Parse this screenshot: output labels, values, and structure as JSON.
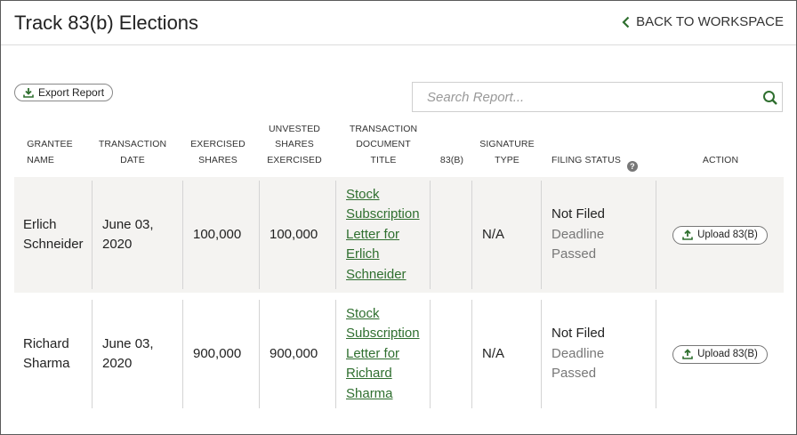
{
  "header": {
    "title": "Track 83(b) Elections",
    "back_label": "BACK TO WORKSPACE"
  },
  "toolbar": {
    "export_label": "Export Report",
    "search_placeholder": "Search Report..."
  },
  "table": {
    "columns": [
      "GRANTEE\nNAME",
      "TRANSACTION\nDATE",
      "EXERCISED\nSHARES",
      "UNVESTED\nSHARES\nEXERCISED",
      "TRANSACTION\nDOCUMENT\nTITLE",
      "83(B)",
      "SIGNATURE\nTYPE",
      "FILING STATUS",
      "ACTION"
    ],
    "rows": [
      {
        "grantee": "Erlich\nSchneider",
        "date": "June 03,\n2020",
        "exercised": "100,000",
        "unvested": "100,000",
        "doc_title": "Stock Subscription Letter for Erlich Schneider",
        "b83": "",
        "signature": "N/A",
        "status": "Not Filed",
        "status_note": "Deadline\nPassed",
        "action": "Upload 83(B)"
      },
      {
        "grantee": "Richard\nSharma",
        "date": "June 03,\n2020",
        "exercised": "900,000",
        "unvested": "900,000",
        "doc_title": "Stock Subscription Letter for Richard Sharma",
        "b83": "",
        "signature": "N/A",
        "status": "Not Filed",
        "status_note": "Deadline\nPassed",
        "action": "Upload 83(B)"
      }
    ]
  },
  "colors": {
    "accent": "#2f6f2f",
    "row_shade": "#f4f3f1"
  }
}
